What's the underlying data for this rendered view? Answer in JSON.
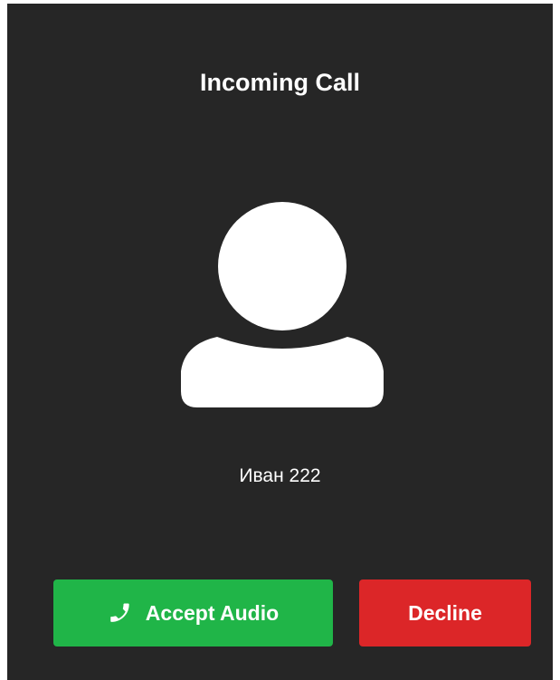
{
  "dialog": {
    "title": "Incoming Call",
    "caller_name": "Иван 222",
    "avatar_icon": "user-avatar-icon",
    "accept_button": {
      "label": "Accept Audio",
      "icon": "phone-icon",
      "color": "#20b548"
    },
    "decline_button": {
      "label": "Decline",
      "color": "#dc2628"
    },
    "background_color": "#262626"
  }
}
